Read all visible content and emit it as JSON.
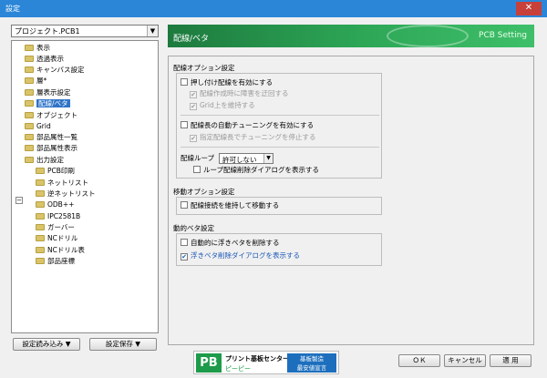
{
  "window": {
    "title": "設定",
    "close_glyph": "✕"
  },
  "project_select": {
    "value": "プロジェクト.PCB1",
    "arrow": "▼"
  },
  "tree": {
    "toggle": "−",
    "items": [
      {
        "label": "表示"
      },
      {
        "label": "透過表示"
      },
      {
        "label": "キャンバス設定"
      },
      {
        "label": "層*"
      },
      {
        "label": "層表示設定"
      },
      {
        "label": "配線/ベタ"
      },
      {
        "label": "オブジェクト"
      },
      {
        "label": "Grid"
      },
      {
        "label": "部品属性一覧"
      },
      {
        "label": "部品属性表示"
      },
      {
        "label": "出力設定"
      },
      {
        "label": "PCB印刷"
      },
      {
        "label": "ネットリスト"
      },
      {
        "label": "逆ネットリスト"
      },
      {
        "label": "ODB++"
      },
      {
        "label": "IPC2581B"
      },
      {
        "label": "ガーバー"
      },
      {
        "label": "NCドリル"
      },
      {
        "label": "NCドリル表"
      },
      {
        "label": "部品座標"
      }
    ]
  },
  "left_buttons": {
    "load": "設定読み込み ▼",
    "save": "設定保存 ▼"
  },
  "header": {
    "title": "配線/ベタ",
    "subtitle": "PCB Setting",
    "accent": "#2ea857"
  },
  "routing_options": {
    "title": "配線オプション設定",
    "push_route": "押し付け配線を有効にする",
    "push_sub1": "配線作成時に障害を迂回する",
    "push_sub2": "Grid上を維持する",
    "tuning": "配線長の自動チューニングを有効にする",
    "tuning_sub": "指定配線長でチューニングを停止する",
    "loop_label": "配線ループ",
    "loop_value": "許可しない",
    "loop_arrow": "▼",
    "loop_dialog": "ループ配線削除ダイアログを表示する"
  },
  "move_options": {
    "title": "移動オプション設定",
    "keep_connection": "配線接続を維持して移動する"
  },
  "dynamic_fill": {
    "title": "動的ベタ設定",
    "auto_delete": "自動的に浮きベタを削除する",
    "show_dialog": "浮きベタ削除ダイアログを表示する",
    "check_glyph": "✔"
  },
  "banner": {
    "logo": "PB",
    "name1": "プリント基板センター",
    "name2": "ピーピー",
    "tag1": "基板製造",
    "tag2": "最安値宣言"
  },
  "bottom_buttons": {
    "ok": "ＯＫ",
    "cancel": "キャンセル",
    "apply": "適 用"
  }
}
